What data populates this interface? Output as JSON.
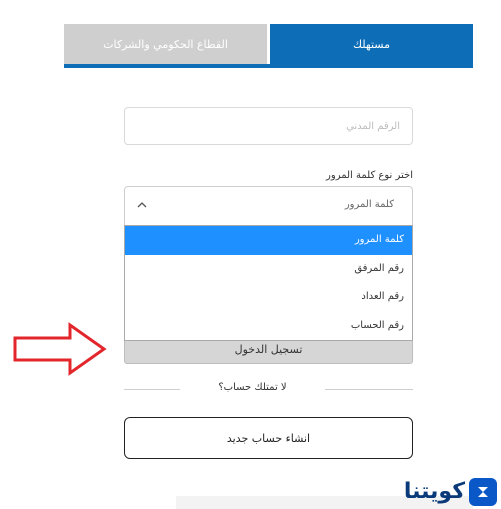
{
  "tabs": {
    "active_label": "مستهلك",
    "inactive_label": "القطاع الحكومي والشركات"
  },
  "civil_id": {
    "placeholder": "الرقم المدني"
  },
  "password_type": {
    "label": "اختر نوع كلمة المرور",
    "selected": "كلمة المرور",
    "options": [
      "كلمة المرور",
      "رقم المرفق",
      "رقم العداد",
      "رقم الحساب"
    ]
  },
  "login_button": "تسجيل الدخول",
  "no_account_text": "لا تمتلك حساب؟",
  "create_account_button": "انشاء حساب جديد",
  "logo_text": "كويتنا",
  "colors": {
    "primary_blue": "#0d6db7",
    "selected_option": "#1e90ff",
    "arrow_red": "#e3262b"
  }
}
